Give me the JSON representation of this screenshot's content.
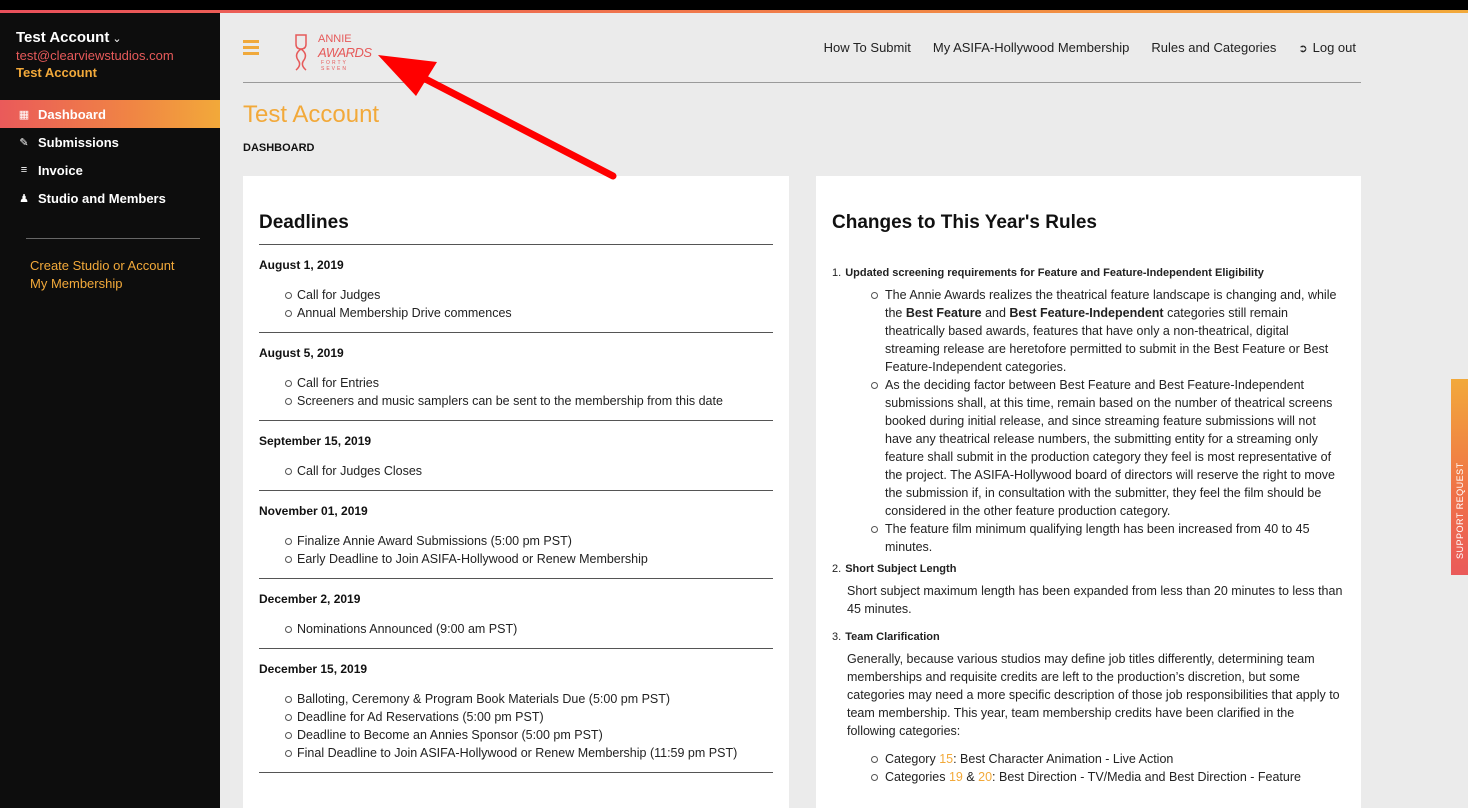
{
  "account": {
    "name": "Test Account",
    "email": "test@clearviewstudios.com",
    "subname": "Test Account"
  },
  "sidebar": {
    "items": [
      {
        "label": "Dashboard",
        "icon": "dashboard-icon"
      },
      {
        "label": "Submissions",
        "icon": "edit-icon"
      },
      {
        "label": "Invoice",
        "icon": "list-icon"
      },
      {
        "label": "Studio and Members",
        "icon": "user-icon"
      }
    ],
    "links": [
      "Create Studio or Account",
      "My Membership"
    ]
  },
  "logo": {
    "line1": "ANNIE",
    "line2": "AWARDS",
    "line3": "FORTY SEVEN"
  },
  "topnav": {
    "how_to_submit": "How To Submit",
    "membership": "My ASIFA-Hollywood Membership",
    "rules": "Rules and Categories",
    "logout": "Log out"
  },
  "page": {
    "title": "Test Account",
    "breadcrumb": "DASHBOARD"
  },
  "deadlines": {
    "heading": "Deadlines",
    "groups": [
      {
        "date": "August 1, 2019",
        "items": [
          "Call for Judges",
          "Annual Membership Drive commences"
        ]
      },
      {
        "date": "August 5, 2019",
        "items": [
          "Call for Entries",
          "Screeners and music samplers can be sent to the membership from this date"
        ]
      },
      {
        "date": "September 15, 2019",
        "items": [
          "Call for Judges Closes"
        ]
      },
      {
        "date": "November 01, 2019",
        "items": [
          "Finalize Annie Award Submissions (5:00 pm PST)",
          "Early Deadline to Join ASIFA-Hollywood or Renew Membership"
        ]
      },
      {
        "date": "December 2, 2019",
        "items": [
          "Nominations Announced (9:00 am PST)"
        ]
      },
      {
        "date": "December 15, 2019",
        "items": [
          "Balloting, Ceremony & Program Book Materials Due (5:00 pm PST)",
          "Deadline for Ad Reservations (5:00 pm PST)",
          "Deadline to Become an Annies Sponsor (5:00 pm PST)",
          "Final Deadline to Join ASIFA-Hollywood or Renew Membership (11:59 pm PST)"
        ]
      }
    ]
  },
  "rules": {
    "heading": "Changes to This Year's Rules",
    "r1": {
      "num": "1.",
      "title": "Updated screening requirements for Feature and Feature-Independent Eligibility",
      "b1_pre": "The Annie Awards realizes the theatrical feature landscape is changing and, while the ",
      "b1_bold1": "Best Feature",
      "b1_mid": " and ",
      "b1_bold2": "Best Feature-Independent",
      "b1_post": " categories still remain theatrically based awards, features that have only a non-theatrical, digital streaming release are heretofore permitted to submit in the Best Feature or Best Feature-Independent categories.",
      "b2": "As the deciding factor between Best Feature and Best Feature-Independent submissions shall, at this time, remain based on the number of theatrical screens booked during initial release, and since streaming feature submissions will not have any theatrical release numbers, the submitting entity for a streaming only feature shall submit in the production category they feel is most representative of the project. The ASIFA-Hollywood board of directors will reserve the right to move the submission if, in consultation with the submitter, they feel the film should be considered in the other feature production category.",
      "b3": "The feature film minimum qualifying length has been increased from 40 to 45 minutes."
    },
    "r2": {
      "num": "2.",
      "title": "Short Subject Length",
      "text": "Short subject maximum length has been expanded from less than 20 minutes to less than 45 minutes."
    },
    "r3": {
      "num": "3.",
      "title": "Team Clarification",
      "text": "Generally, because various studios may define job titles differently, determining team memberships and requisite credits are left to the production’s discretion, but some categories may need a more specific description of those job responsibilities that apply to team membership. This year, team membership credits have been clarified in the following categories:",
      "c1_pre": "Category ",
      "c1_num": "15",
      "c1_post": ": Best Character Animation - Live Action",
      "c2_pre": "Categories ",
      "c2_num1": "19",
      "c2_amp": " & ",
      "c2_num2": "20",
      "c2_post": ": Best Direction - TV/Media and Best Direction - Feature"
    }
  },
  "support": {
    "label": "SUPPORT REQUEST"
  },
  "colors": {
    "accent": "#f2a93a",
    "brand_red": "#e65a5a",
    "arrow": "#ff0000"
  }
}
